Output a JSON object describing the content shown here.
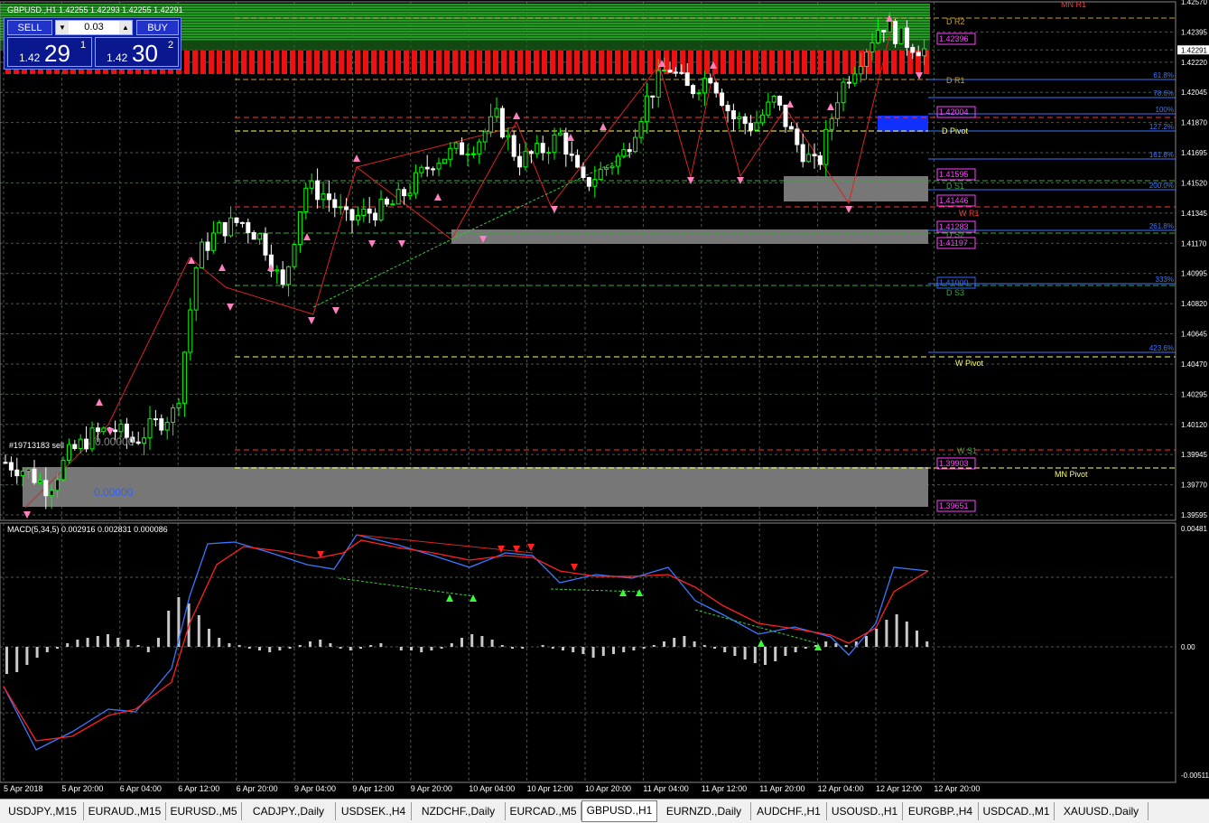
{
  "chart": {
    "title": "GBPUSD.,H1  1.42255 1.42293 1.42255 1.42291",
    "indicator_label": "MACD(5,34,5) 0.002916 0.002831 0.000086",
    "order_label": "#19713183 sell",
    "order_value_1": "0.00000",
    "order_value_2": "0.00000",
    "price_axis": [
      "1.42570",
      "1.42395",
      "1.42291",
      "1.42220",
      "1.42045",
      "1.41870",
      "1.41695",
      "1.41520",
      "1.41345",
      "1.41170",
      "1.40995",
      "1.40820",
      "1.40645",
      "1.40470",
      "1.40295",
      "1.40120",
      "1.39945",
      "1.39770",
      "1.39595"
    ],
    "macd_axis": [
      "0.00481",
      "0.00",
      "-0.00511"
    ],
    "time_axis": [
      "5 Apr 2018",
      "5 Apr 20:00",
      "6 Apr 04:00",
      "6 Apr 12:00",
      "6 Apr 20:00",
      "9 Apr 04:00",
      "9 Apr 12:00",
      "9 Apr 20:00",
      "10 Apr 04:00",
      "10 Apr 12:00",
      "10 Apr 20:00",
      "11 Apr 04:00",
      "11 Apr 12:00",
      "11 Apr 20:00",
      "12 Apr 04:00",
      "12 Apr 12:00",
      "12 Apr 20:00"
    ],
    "level_labels": [
      {
        "text": "D R2",
        "color": "#c8a020"
      },
      {
        "text": "1.42396",
        "color": "#ff40ff"
      },
      {
        "text": "D R1",
        "color": "#c8a020"
      },
      {
        "text": "1.42004",
        "color": "#ff40ff"
      },
      {
        "text": "D Pivot",
        "color": "#ffff66"
      },
      {
        "text": "1.41595",
        "color": "#ff40ff"
      },
      {
        "text": "D S1",
        "color": "#33aa33"
      },
      {
        "text": "1.41446",
        "color": "#ff40ff"
      },
      {
        "text": "W R1",
        "color": "#ff3333"
      },
      {
        "text": "1.41283",
        "color": "#ff40ff"
      },
      {
        "text": "D S2",
        "color": "#33aa33"
      },
      {
        "text": "1.41197",
        "color": "#ff40ff"
      },
      {
        "text": "1.41000",
        "color": "#3366ff"
      },
      {
        "text": "D S3",
        "color": "#33aa33"
      },
      {
        "text": "W Pivot",
        "color": "#ffff66"
      },
      {
        "text": "W S1",
        "color": "#33aa33"
      },
      {
        "text": "1.39903",
        "color": "#ff40ff"
      },
      {
        "text": "MN Pivot",
        "color": "#ffff66"
      },
      {
        "text": "1.39651",
        "color": "#ff40ff"
      },
      {
        "text": "MN R1",
        "color": "#ff3333"
      }
    ],
    "fib_labels": [
      "61.8%",
      "78.6%",
      "100%",
      "127.2%",
      "161.8%",
      "200.0%",
      "261.8%",
      "333%",
      "423.6%"
    ]
  },
  "trade_panel": {
    "sell_label": "SELL",
    "buy_label": "BUY",
    "lot": "0.03",
    "sell_prefix": "1.42",
    "sell_big": "29",
    "sell_sup": "1",
    "buy_prefix": "1.42",
    "buy_big": "30",
    "buy_sup": "2"
  },
  "tabs": [
    "USDJPY.,M15",
    "EURAUD.,M15",
    "EURUSD.,M5",
    "CADJPY.,Daily",
    "USDSEK.,H4",
    "NZDCHF.,Daily",
    "EURCAD.,M5",
    "GBPUSD.,H1",
    "EURNZD.,Daily",
    "AUDCHF.,H1",
    "USOUSD.,H1",
    "EURGBP.,H4",
    "USDCAD.,M1",
    "XAUUSD.,Daily"
  ],
  "active_tab": "GBPUSD.,H1",
  "colors": {
    "bull": "#00ff00",
    "bear": "#ffffff",
    "macd": "#3a78ff",
    "signal": "#ff2020",
    "grid": "#4a5a4a"
  }
}
